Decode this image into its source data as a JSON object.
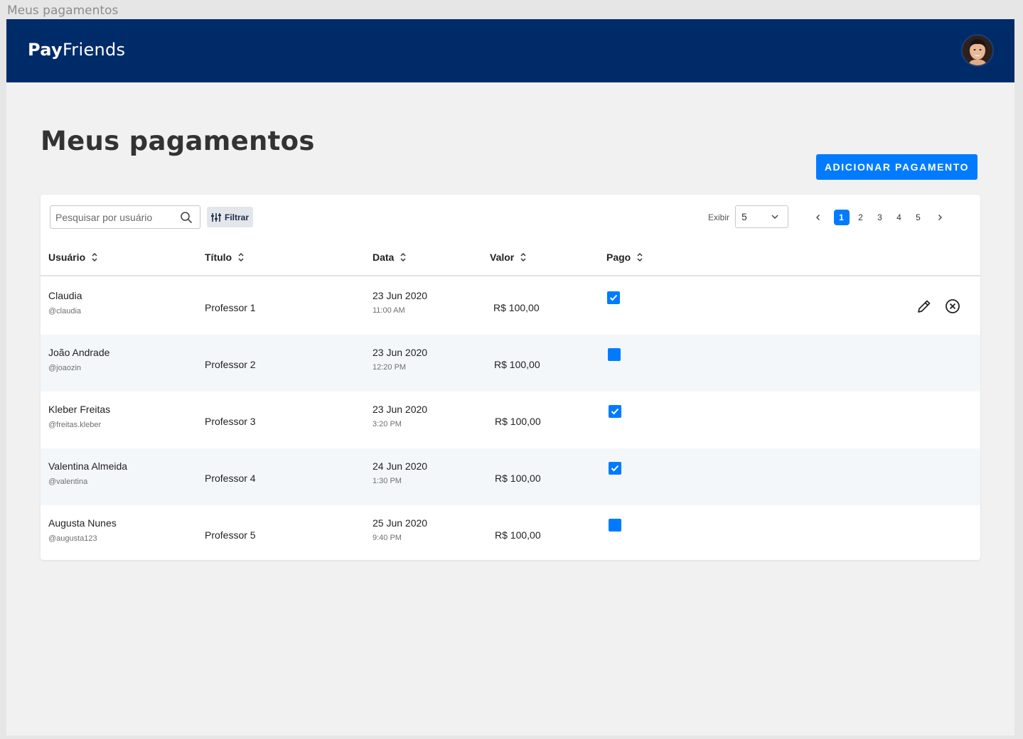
{
  "frame_label": "Meus pagamentos",
  "header": {
    "logo_bold": "Pay",
    "logo_light": "Friends",
    "brand_color": "#002b69"
  },
  "page": {
    "title": "Meus pagamentos",
    "add_button": "ADICIONAR PAGAMENTO",
    "accent_color": "#007bff"
  },
  "toolbar": {
    "search_placeholder": "Pesquisar por usuário",
    "filter_label": "Filtrar",
    "exibir_label": "Exibir",
    "exibir_value": "5",
    "pages": [
      "1",
      "2",
      "3",
      "4",
      "5"
    ],
    "current_page": "1"
  },
  "table": {
    "columns": [
      "Usuário",
      "Título",
      "Data",
      "Valor",
      "Pago"
    ],
    "rows": [
      {
        "name": "Claudia",
        "handle": "@claudia",
        "title": "Professor 1",
        "date": "23 Jun 2020",
        "time": "11:00 AM",
        "value": "R$ 100,00",
        "paid": true
      },
      {
        "name": "João Andrade",
        "handle": "@joaozin",
        "title": "Professor 2",
        "date": "23 Jun 2020",
        "time": "12:20 PM",
        "value": "R$ 100,00",
        "paid": false
      },
      {
        "name": "Kleber Freitas",
        "handle": "@freitas.kleber",
        "title": "Professor 3",
        "date": "23 Jun 2020",
        "time": "3:20 PM",
        "value": "R$ 100,00",
        "paid": true
      },
      {
        "name": "Valentina Almeida",
        "handle": "@valentina",
        "title": "Professor 4",
        "date": "24 Jun 2020",
        "time": "1:30 PM",
        "value": "R$ 100,00",
        "paid": true
      },
      {
        "name": "Augusta Nunes",
        "handle": "@augusta123",
        "title": "Professor 5",
        "date": "25 Jun 2020",
        "time": "9:40 PM",
        "value": "R$ 100,00",
        "paid": false
      }
    ]
  }
}
